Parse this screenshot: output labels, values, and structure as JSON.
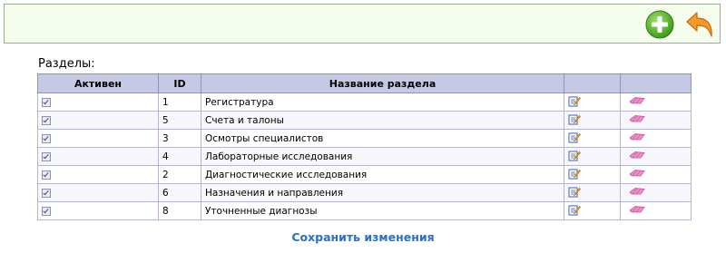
{
  "toolbar": {
    "add_icon": "add-circle-icon",
    "back_icon": "back-arrow-icon",
    "colors": {
      "background": "#f4fcee",
      "add": "#5ab52c",
      "back": "#f08a1c"
    }
  },
  "section": {
    "title": "Разделы:"
  },
  "table": {
    "headers": [
      "Активен",
      "ID",
      "Название раздела",
      "",
      ""
    ],
    "rows": [
      {
        "active": true,
        "id": "1",
        "name": "Регистратура"
      },
      {
        "active": true,
        "id": "5",
        "name": "Счета и талоны"
      },
      {
        "active": true,
        "id": "3",
        "name": "Осмотры специалистов"
      },
      {
        "active": true,
        "id": "4",
        "name": "Лабораторные исследования"
      },
      {
        "active": true,
        "id": "2",
        "name": "Диагностические исследования"
      },
      {
        "active": true,
        "id": "6",
        "name": "Назначения и направления"
      },
      {
        "active": true,
        "id": "8",
        "name": "Уточненные диагнозы"
      }
    ],
    "row_icons": {
      "edit": "edit-icon",
      "delete": "eraser-icon"
    },
    "colors": {
      "header_bg": "#c6c9e3"
    }
  },
  "footer": {
    "save_label": "Сохранить изменения",
    "save_color": "#2a6fc9"
  }
}
